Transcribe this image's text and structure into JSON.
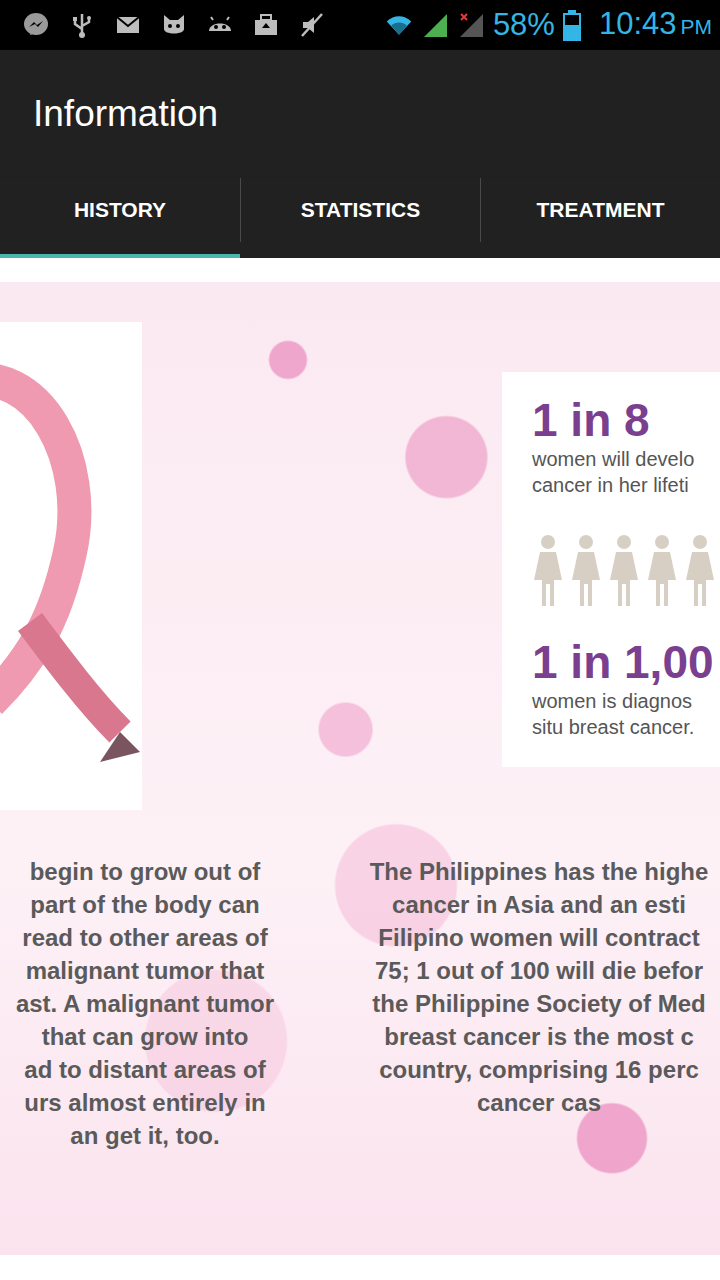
{
  "status_bar": {
    "battery": "58%",
    "battery_level": 0.58,
    "time": "10:43",
    "meridiem": "PM"
  },
  "app_bar": {
    "title": "Information"
  },
  "tabs": [
    {
      "label": "HISTORY",
      "selected": true
    },
    {
      "label": "STATISTICS",
      "selected": false
    },
    {
      "label": "TREATMENT",
      "selected": false
    }
  ],
  "pages": [
    {
      "text_lines": [
        "begin to grow out of",
        "part of the body can",
        "read to other areas of",
        "malignant tumor that",
        "ast. A malignant tumor",
        "that can grow into",
        "ad to distant areas of",
        "urs almost entirely in",
        "an get it, too."
      ]
    },
    {
      "infographic": {
        "stats": [
          {
            "figure": "1 in 8",
            "caption": [
              "women will develo",
              "cancer in her lifeti"
            ]
          },
          {
            "figure": "1 in 1,00",
            "caption": [
              "women is diagnos",
              "situ breast cancer."
            ]
          }
        ]
      },
      "text_lines": [
        "The Philippines has the highe",
        "cancer in Asia and an esti",
        "Filipino women will contract",
        "75; 1 out of 100 will die befor",
        "the Philippine Society of Med",
        "breast cancer is the most c",
        "country, comprising 16 perc",
        "cancer cas"
      ]
    }
  ]
}
